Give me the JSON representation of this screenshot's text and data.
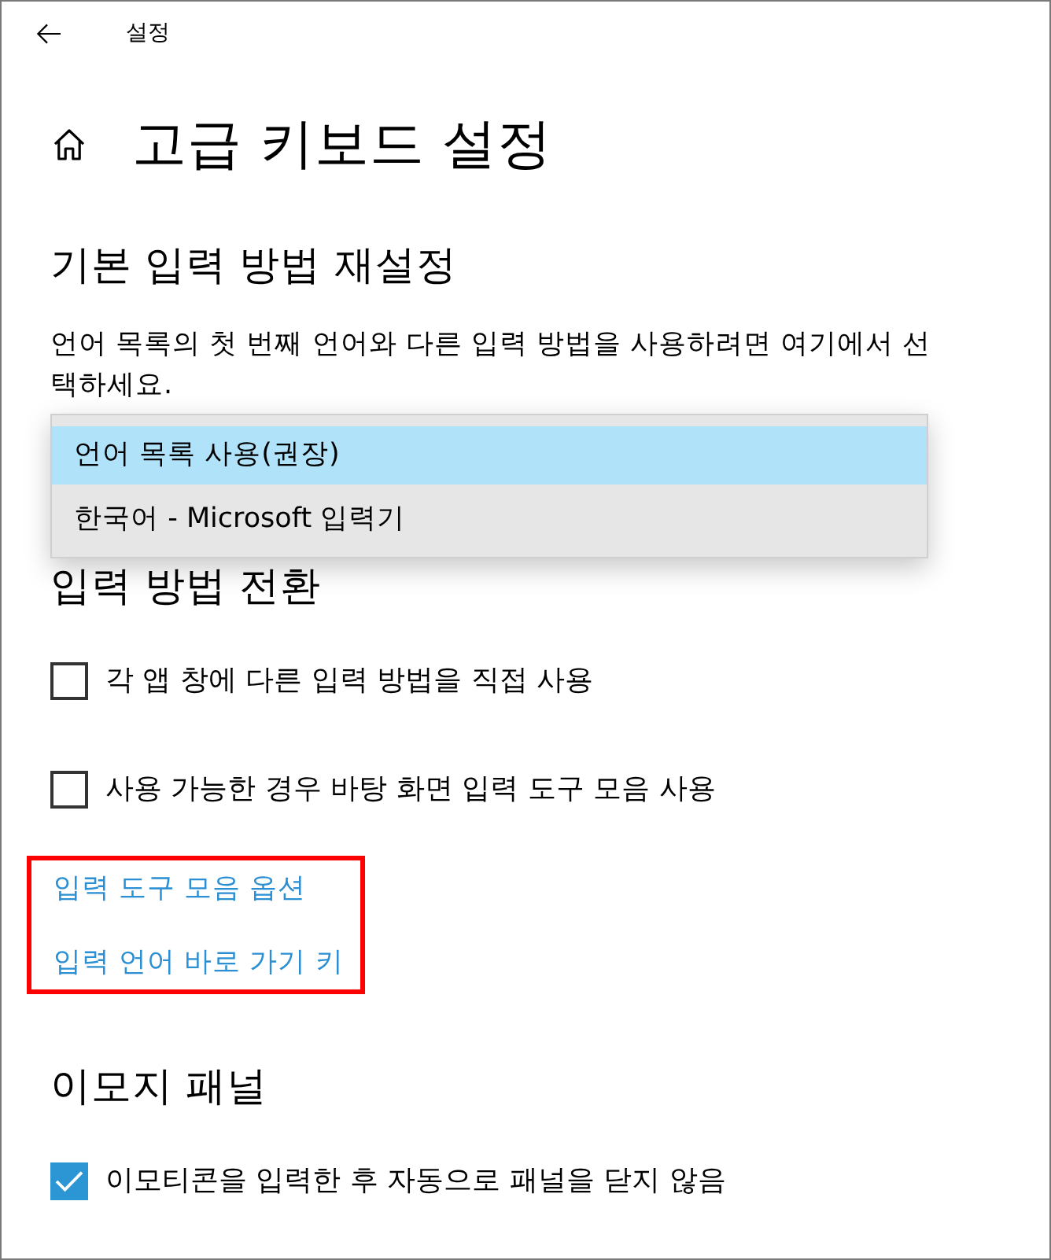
{
  "window": {
    "title": "설정"
  },
  "page": {
    "title": "고급 키보드 설정"
  },
  "sections": [
    {
      "kind": "dropdown",
      "heading": "기본 입력 방법 재설정",
      "description": "언어 목록의 첫 번째 언어와 다른 입력 방법을 사용하려면 여기에서 선택하세요.",
      "dropdown": {
        "expanded": true,
        "options": [
          {
            "label": "언어 목록 사용(권장)",
            "selected": true
          },
          {
            "label": "한국어 - Microsoft 입력기",
            "selected": false
          }
        ]
      }
    },
    {
      "kind": "checks",
      "heading": "입력 방법 전환",
      "checkboxes": [
        {
          "label": "각 앱 창에 다른 입력 방법을 직접 사용",
          "checked": false
        },
        {
          "label": "사용 가능한 경우 바탕 화면 입력 도구 모음 사용",
          "checked": false
        }
      ],
      "links": {
        "highlighted": true,
        "items": [
          "입력 도구 모음 옵션",
          "입력 언어 바로 가기 키"
        ]
      }
    },
    {
      "kind": "checks",
      "heading": "이모지 패널",
      "checkboxes": [
        {
          "label": "이모티콘을 입력한 후 자동으로 패널을 닫지 않음",
          "checked": true
        }
      ]
    }
  ]
}
